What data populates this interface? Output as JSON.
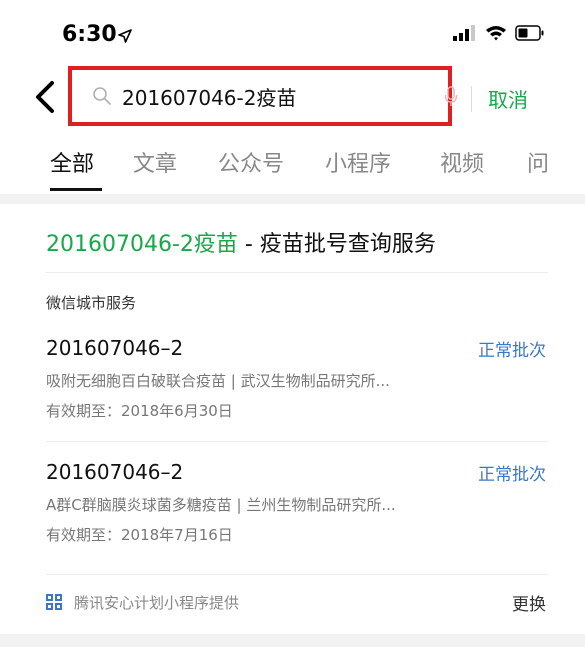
{
  "status_bar": {
    "time": "6:30",
    "location_icon": "location-arrow-icon",
    "signal_icon": "cellular-signal-icon",
    "wifi_icon": "wifi-icon",
    "battery_icon": "battery-icon"
  },
  "search": {
    "query": "201607046-2疫苗",
    "cancel_label": "取消",
    "back_icon": "chevron-left-icon",
    "search_icon": "search-icon",
    "mic_icon": "microphone-icon",
    "highlight_color": "#e02020"
  },
  "tabs": [
    {
      "label": "全部",
      "active": true
    },
    {
      "label": "文章",
      "active": false
    },
    {
      "label": "公众号",
      "active": false
    },
    {
      "label": "小程序",
      "active": false
    },
    {
      "label": "视频",
      "active": false
    },
    {
      "label": "问",
      "active": false
    }
  ],
  "card": {
    "title_highlight": "201607046-2疫苗",
    "title_rest": " - 疫苗批号查询服务",
    "source": "微信城市服务",
    "results": [
      {
        "batch": "201607046–2",
        "status": "正常批次",
        "description": "吸附无细胞百白破联合疫苗 | 武汉生物制品研究所...",
        "expiry": "有效期至：2018年6月30日"
      },
      {
        "batch": "201607046–2",
        "status": "正常批次",
        "description": "A群C群脑膜炎球菌多糖疫苗 | 兰州生物制品研究所...",
        "expiry": "有效期至：2018年7月16日"
      }
    ],
    "footer_icon": "mini-program-icon",
    "footer_text": "腾讯安心计划小程序提供",
    "change_label": "更换"
  },
  "colors": {
    "accent_green": "#17a84a",
    "status_blue": "#3b77c9"
  }
}
